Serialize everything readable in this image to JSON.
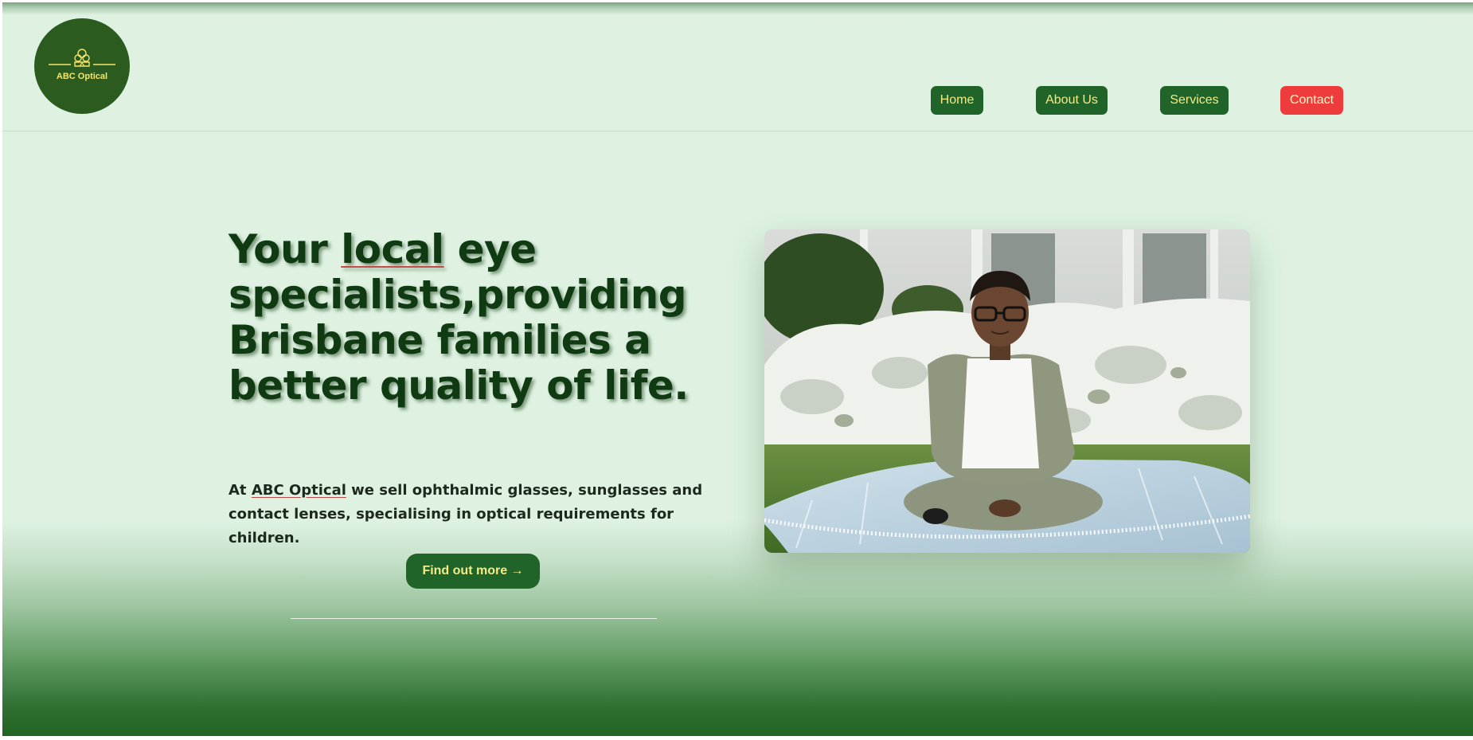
{
  "header": {
    "logo_text": "ABC Optical",
    "logo_icon": "optician-icon",
    "nav": [
      {
        "label": "Home",
        "active": false
      },
      {
        "label": "About Us",
        "active": false
      },
      {
        "label": "Services",
        "active": false
      },
      {
        "label": "Contact",
        "active": true
      }
    ]
  },
  "hero": {
    "headline_before": "Your ",
    "headline_underlined": "local",
    "headline_after": " eye specialists,providing Brisbane families a better quality of life.",
    "intro_before": "At ",
    "intro_brand": "ABC Optical",
    "intro_after": " we sell ophthalmic glasses, sunglasses and contact lenses, specialising in optical requirements for children.",
    "cta_label": "Find out more →",
    "photo_subject": "boy-with-glasses-photo"
  },
  "colors": {
    "background": "#dff2e2",
    "brand_green": "#21642a",
    "logo_green": "#2c5b1f",
    "button_text": "#f6ea84",
    "contact_red": "#ee3c3c",
    "headline": "#0f3a12"
  }
}
